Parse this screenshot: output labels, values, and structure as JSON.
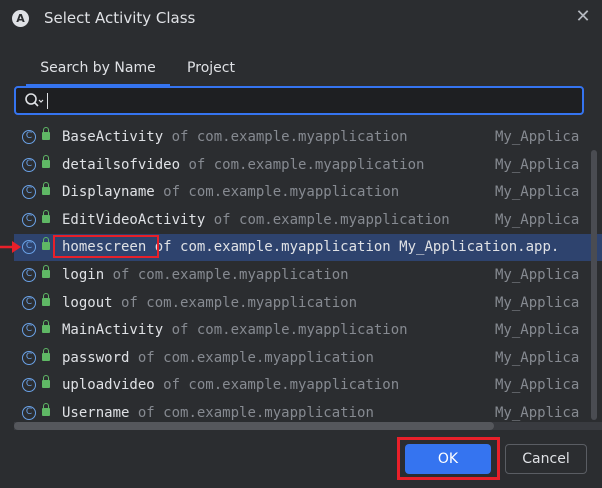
{
  "window": {
    "title": "Select Activity Class",
    "app_icon_glyph": "A",
    "close_glyph": "✕"
  },
  "tabs": [
    {
      "label": "Search by Name",
      "active": true
    },
    {
      "label": "Project",
      "active": false
    }
  ],
  "search": {
    "value": "",
    "icon": "search-icon"
  },
  "list": {
    "items": [
      {
        "name": "BaseActivity",
        "pkg": "of com.example.myapplication",
        "module": "My_Applica"
      },
      {
        "name": "detailsofvideo",
        "pkg": "of com.example.myapplication",
        "module": "My_Applica"
      },
      {
        "name": "Displayname",
        "pkg": "of com.example.myapplication",
        "module": "My_Applica"
      },
      {
        "name": "EditVideoActivity",
        "pkg": "of com.example.myapplication",
        "module": "My_Applica"
      },
      {
        "name": "homescreen",
        "pkg": "of com.example.myapplication My_Application.app.",
        "module": "",
        "selected": true
      },
      {
        "name": "login",
        "pkg": "of com.example.myapplication",
        "module": "My_Applica"
      },
      {
        "name": "logout",
        "pkg": "of com.example.myapplication",
        "module": "My_Applica"
      },
      {
        "name": "MainActivity",
        "pkg": "of com.example.myapplication",
        "module": "My_Applica"
      },
      {
        "name": "password",
        "pkg": "of com.example.myapplication",
        "module": "My_Applica"
      },
      {
        "name": "uploadvideo",
        "pkg": "of com.example.myapplication",
        "module": "My_Applica"
      },
      {
        "name": "Username",
        "pkg": "of com.example.myapplication",
        "module": "My_Applica"
      }
    ]
  },
  "buttons": {
    "ok": "OK",
    "cancel": "Cancel"
  },
  "colors": {
    "accent": "#3574f0",
    "highlight": "#e8202a",
    "selection": "#2e436e"
  }
}
